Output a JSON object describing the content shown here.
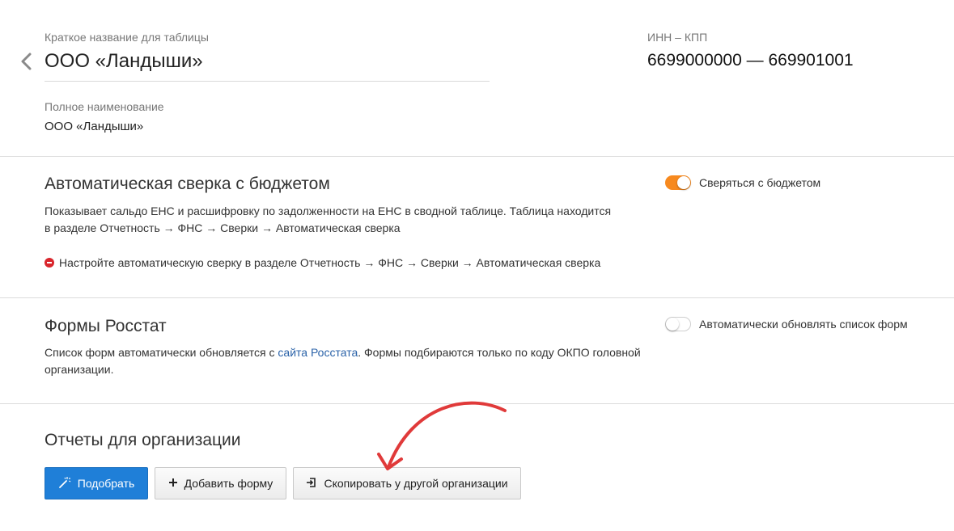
{
  "header": {
    "short_name_label": "Краткое название для таблицы",
    "short_name_value": "ООО «Ландыши»",
    "inn_kpp_label": "ИНН – КПП",
    "inn_kpp_value": "6699000000 — 669901001",
    "full_name_label": "Полное наименование",
    "full_name_value": "ООО «Ландыши»"
  },
  "budget_check": {
    "title": "Автоматическая сверка с бюджетом",
    "desc_line1": "Показывает сальдо ЕНС и расшифровку по задолженности на ЕНС в сводной таблице. Таблица находится",
    "desc_line2": "в разделе Отчетность → ФНС → Сверки → Автоматическая сверка",
    "error_text": "Настройте автоматическую сверку в разделе Отчетность → ФНС → Сверки → Автоматическая сверка",
    "toggle_label": "Сверяться с бюджетом",
    "toggle_on": true
  },
  "rosstat": {
    "title": "Формы Росстат",
    "desc_before_link": "Список форм автоматически обновляется с ",
    "desc_link": "сайта Росстата",
    "desc_after_link": ". Формы подбираются только по коду ОКПО головной",
    "desc_line2": "организации.",
    "toggle_label": "Автоматически обновлять список форм",
    "toggle_on": false
  },
  "reports": {
    "title": "Отчеты для организации",
    "pick_button": "Подобрать",
    "add_form_button": "Добавить форму",
    "copy_button": "Скопировать у другой организации"
  },
  "colors": {
    "accent": "#f7891e",
    "primary_button": "#1f7fd8",
    "error": "#d9262c",
    "link": "#2a62a8",
    "annotation_arrow": "#e03a3a"
  },
  "icons": {
    "back": "chevron-left-icon",
    "pick": "magic-wand-icon",
    "add": "plus-icon",
    "copy": "copy-import-icon",
    "error": "error-minus-icon"
  }
}
